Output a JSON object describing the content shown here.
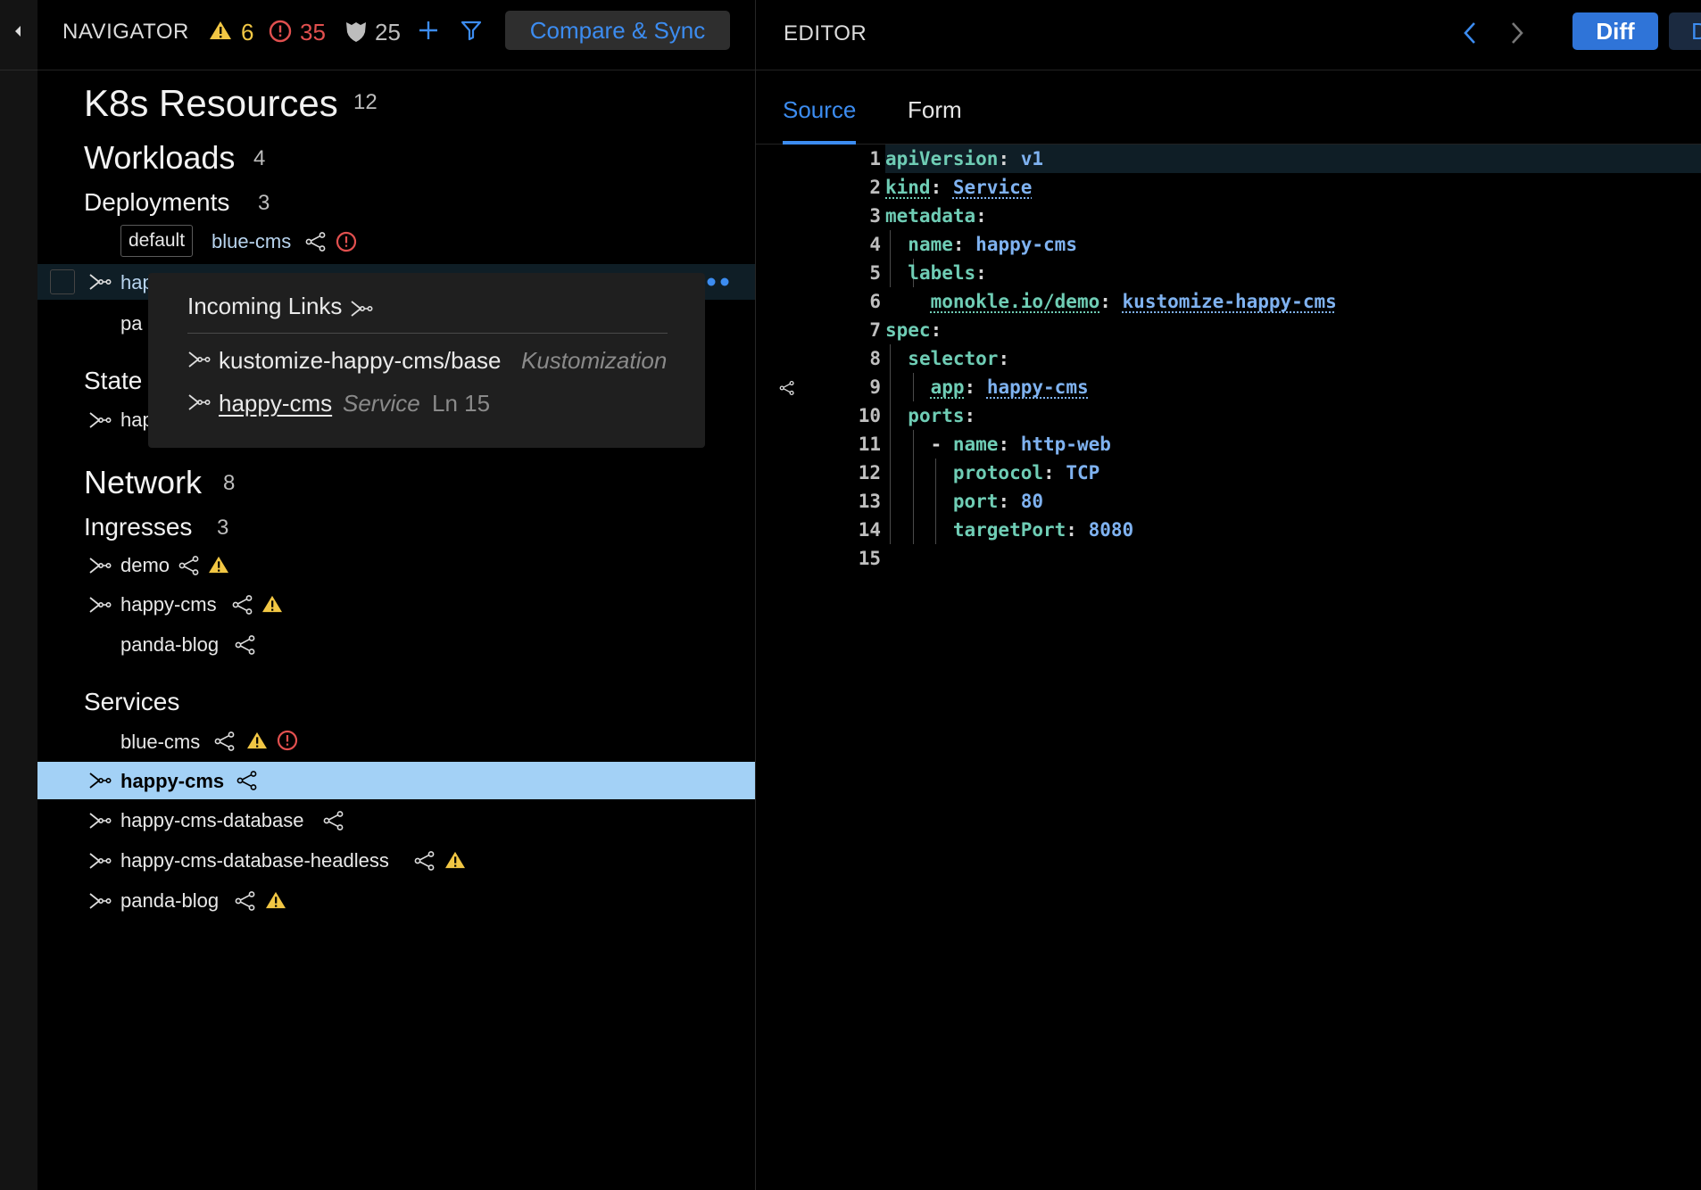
{
  "navigator": {
    "title": "NAVIGATOR",
    "warnings": "6",
    "errors": "35",
    "policy": "25",
    "compare_sync": "Compare & Sync"
  },
  "tree": {
    "root_title": "K8s Resources",
    "root_count": "12",
    "workloads": "Workloads",
    "workloads_count": "4",
    "deployments": "Deployments",
    "deployments_count": "3",
    "namespace_badge": "default",
    "dep_item1": "blue-cms",
    "dep_item2": "hap",
    "dep_item3": "pa",
    "statefulsets": "State",
    "sts_item1": "hap",
    "network": "Network",
    "network_count": "8",
    "ingresses": "Ingresses",
    "ingresses_count": "3",
    "ing_items": [
      "demo",
      "happy-cms",
      "panda-blog"
    ],
    "services": "Services",
    "svc_items": [
      "blue-cms",
      "happy-cms",
      "happy-cms-database",
      "happy-cms-database-headless",
      "panda-blog"
    ]
  },
  "popup": {
    "title": "Incoming Links",
    "link1_name": "kustomize-happy-cms/base",
    "link1_kind": "Kustomization",
    "link2_name": "happy-cms",
    "link2_kind": "Service",
    "link2_line": "Ln 15"
  },
  "editor": {
    "title": "EDITOR",
    "diff": "Diff",
    "next_btn": "D",
    "tabs": [
      "Source",
      "Form"
    ],
    "line_numbers": [
      "1",
      "2",
      "3",
      "4",
      "5",
      "6",
      "7",
      "8",
      "9",
      "10",
      "11",
      "12",
      "13",
      "14",
      "15"
    ],
    "code": {
      "l1k": "apiVersion",
      "l1v": "v1",
      "l2k": "kind",
      "l2v": "Service",
      "l3k": "metadata",
      "l4k": "name",
      "l4v": "happy-cms",
      "l5k": "labels",
      "l6k": "monokle.io/demo",
      "l6v": "kustomize-happy-cms",
      "l7k": "spec",
      "l8k": "selector",
      "l9k": "app",
      "l9v": "happy-cms",
      "l10k": "ports",
      "l11k": "name",
      "l11v": "http-web",
      "l12k": "protocol",
      "l12v": "TCP",
      "l13k": "port",
      "l13v": "80",
      "l14k": "targetPort",
      "l14v": "8080"
    }
  },
  "colors": {
    "accent": "#3c8cf0",
    "selected_row": "#a3d1f6",
    "warning": "#f2c744",
    "error": "#e2504f",
    "yaml_key": "#6fcdb5",
    "yaml_value": "#7fb2f0"
  }
}
